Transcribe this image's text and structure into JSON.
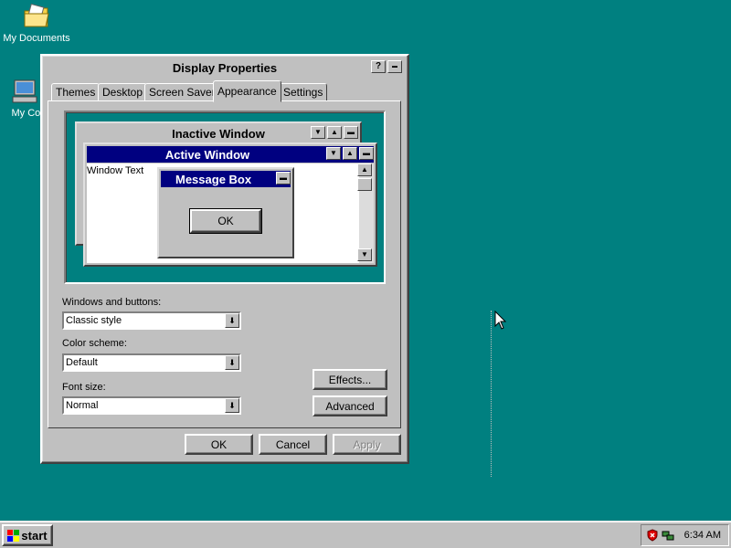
{
  "desktop": {
    "icons": [
      {
        "label": "My Documents",
        "icon": "folder-documents-icon"
      },
      {
        "label": "My Com",
        "icon": "my-computer-icon"
      }
    ]
  },
  "window": {
    "title": "Display Properties",
    "help_glyph": "?",
    "minimize_glyph": "▬",
    "tabs": [
      {
        "label": "Themes",
        "active": false
      },
      {
        "label": "Desktop",
        "active": false
      },
      {
        "label": "Screen Saver",
        "active": false
      },
      {
        "label": "Appearance",
        "active": true
      },
      {
        "label": "Settings",
        "active": false
      }
    ],
    "preview": {
      "inactive_title": "Inactive Window",
      "active_title": "Active Window",
      "window_text": "Window Text",
      "message_box_title": "Message Box",
      "ok_label": "OK",
      "active_title_color": "#000080",
      "inactive_title_color": "#c0c0c0"
    },
    "windows_buttons": {
      "label": "Windows and buttons:",
      "value": "Classic style"
    },
    "color_scheme": {
      "label": "Color scheme:",
      "value": "Default"
    },
    "font_size": {
      "label": "Font size:",
      "value": "Normal"
    },
    "effects_label": "Effects...",
    "advanced_label": "Advanced",
    "ok_label": "OK",
    "cancel_label": "Cancel",
    "apply_label": "Apply"
  },
  "taskbar": {
    "start_label": "start",
    "clock": "6:34 AM",
    "tray_icons": [
      "security-shield-icon",
      "network-icon"
    ]
  },
  "colors": {
    "desktop": "#008080",
    "face": "#c0c0c0",
    "active_title": "#000080"
  }
}
